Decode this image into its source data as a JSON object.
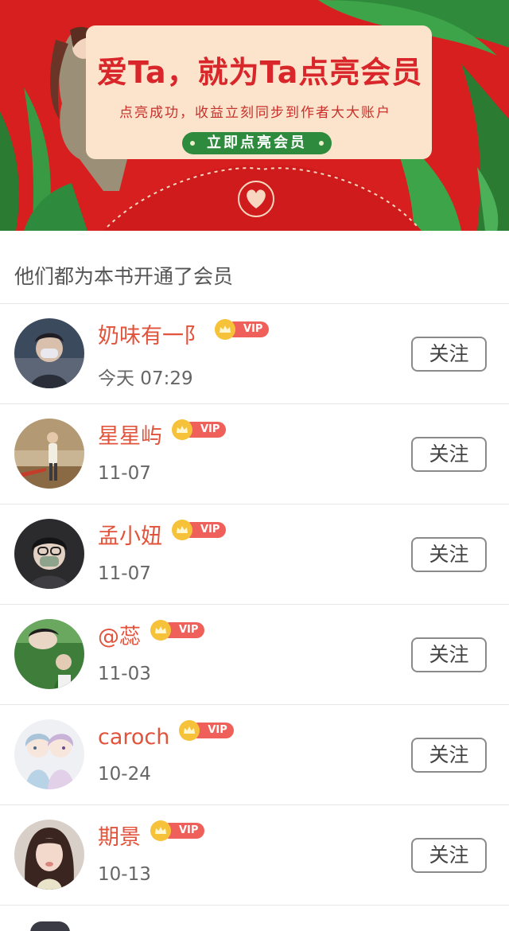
{
  "banner": {
    "title": "爱Ta，就为Ta点亮会员",
    "subtitle": "点亮成功，收益立刻同步到作者大大账户",
    "button_label": "立即点亮会员",
    "background_color": "#d71f1f",
    "card_color": "#fbe4cb",
    "button_color": "#2e8a3c"
  },
  "section": {
    "title": "他们都为本书开通了会员"
  },
  "vip_badge_label": "VIP",
  "follow_label": "关注",
  "members": [
    {
      "name": "奶味有一阝",
      "date": "今天 07:29",
      "avatar": "avatar-masked-man-photo"
    },
    {
      "name": "星星屿",
      "date": "11-07",
      "avatar": "avatar-outdoor-figure-photo"
    },
    {
      "name": "孟小妞",
      "date": "11-07",
      "avatar": "avatar-masked-person-photo"
    },
    {
      "name": "@蕊",
      "date": "11-03",
      "avatar": "avatar-green-scene-photo"
    },
    {
      "name": "caroch",
      "date": "10-24",
      "avatar": "avatar-anime-girls-illustration"
    },
    {
      "name": "期景",
      "date": "10-13",
      "avatar": "avatar-woman-portrait-photo"
    }
  ],
  "colors": {
    "name_text": "#e2533b",
    "vip_pill": "#f0605a",
    "crown": "#f6c23a"
  }
}
